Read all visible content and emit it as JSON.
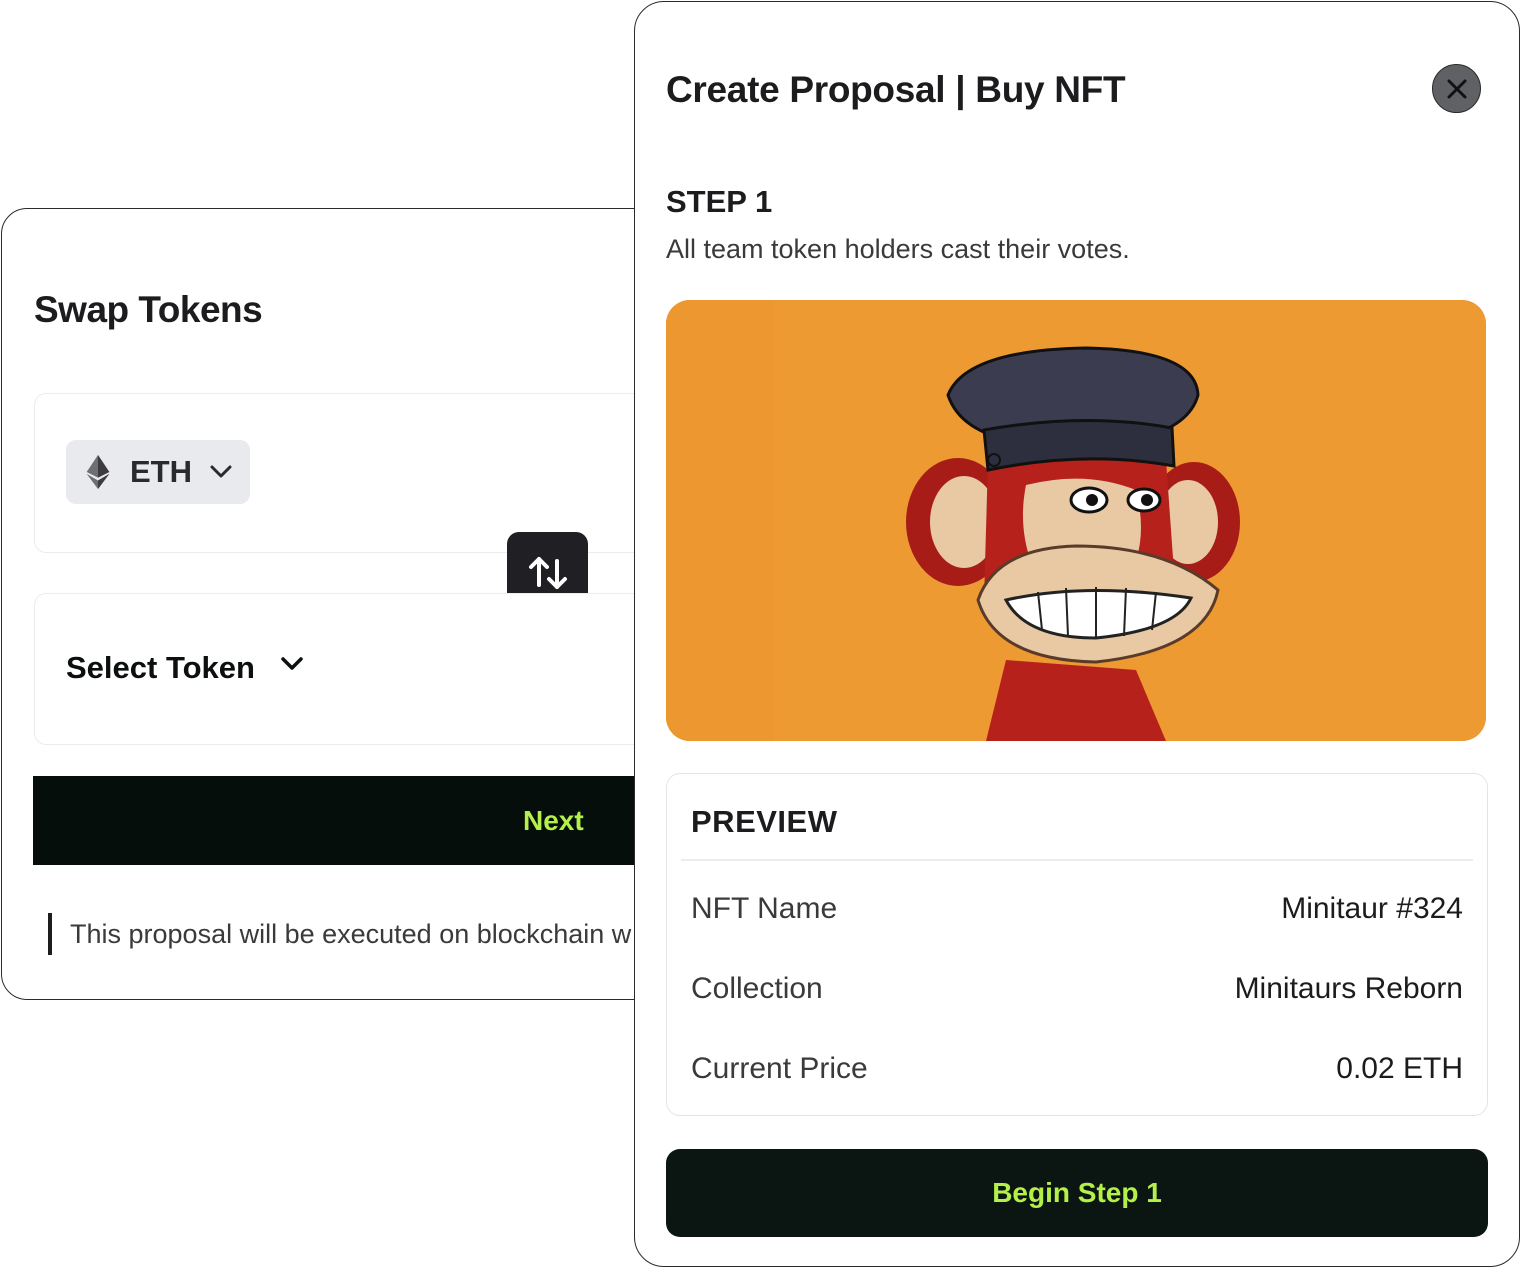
{
  "swap": {
    "title": "Swap Tokens",
    "from_token": {
      "symbol": "ETH",
      "icon": "ethereum-icon"
    },
    "to_token": {
      "label": "Select Token"
    },
    "switch_icon": "swap-arrows-icon",
    "next_label": "Next",
    "note": "This proposal will be executed on blockchain w"
  },
  "modal": {
    "title": "Create Proposal | Buy NFT",
    "close_icon": "close-icon",
    "step": {
      "label": "STEP 1",
      "description": "All team token holders cast their votes."
    },
    "image": {
      "subject": "nft-ape-artwork",
      "background": "#ee9a32"
    },
    "preview": {
      "title": "PREVIEW",
      "rows": [
        {
          "key": "NFT Name",
          "value": "Minitaur #324"
        },
        {
          "key": "Collection",
          "value": "Minitaurs Reborn"
        },
        {
          "key": "Current Price",
          "value": "0.02 ETH"
        }
      ]
    },
    "begin_label": "Begin Step 1"
  },
  "colors": {
    "accent_text": "#b4f04a",
    "button_dark": "#0b1511",
    "nft_background": "#ee9a32"
  }
}
